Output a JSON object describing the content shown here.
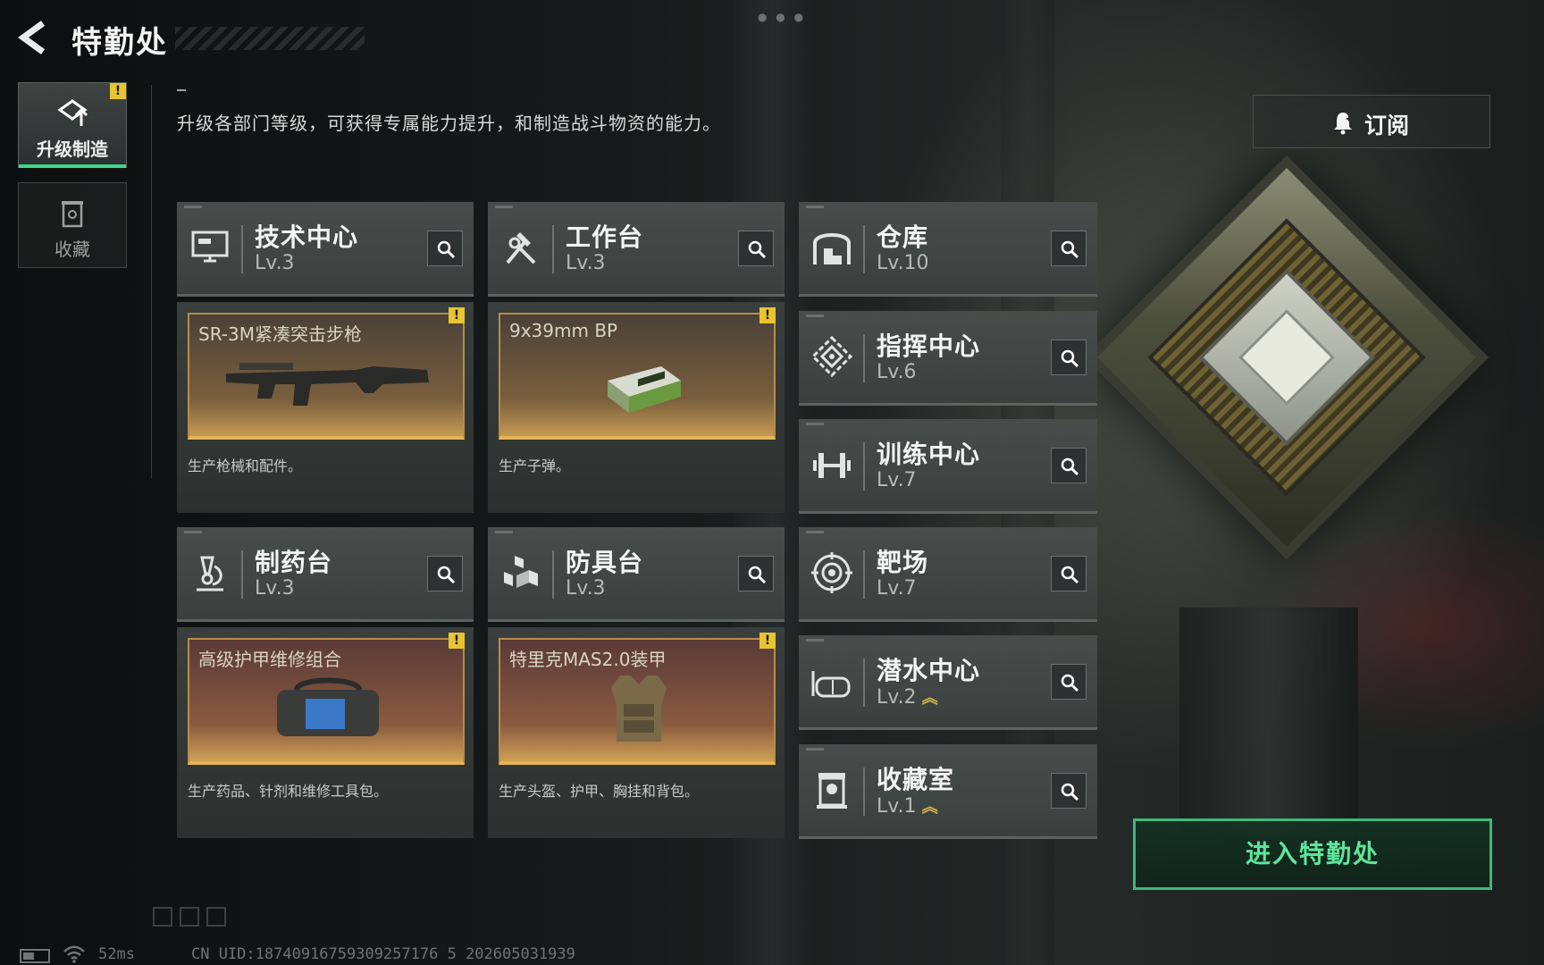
{
  "header": {
    "title": "特勤处"
  },
  "nav": {
    "tabs": [
      {
        "label": "升级制造",
        "icon": "upgrade-icon",
        "badge": "!"
      },
      {
        "label": "收藏",
        "icon": "collection-icon"
      }
    ]
  },
  "main": {
    "description": "升级各部门等级，可获得专属能力提升，和制造战斗物资的能力。",
    "subscribe_label": "订阅",
    "enter_label": "进入特勤处"
  },
  "facilities": [
    {
      "name": "技术中心",
      "level": "Lv.3",
      "icon": "computer-icon"
    },
    {
      "name": "工作台",
      "level": "Lv.3",
      "icon": "hammer-wrench-icon"
    },
    {
      "name": "仓库",
      "level": "Lv.10",
      "icon": "warehouse-icon"
    },
    {
      "name": "指挥中心",
      "level": "Lv.6",
      "icon": "command-icon"
    },
    {
      "name": "训练中心",
      "level": "Lv.7",
      "icon": "dumbbell-icon"
    },
    {
      "name": "制药台",
      "level": "Lv.3",
      "icon": "microscope-icon"
    },
    {
      "name": "防具台",
      "level": "Lv.3",
      "icon": "armor-blocks-icon"
    },
    {
      "name": "靶场",
      "level": "Lv.7",
      "icon": "target-icon"
    },
    {
      "name": "潜水中心",
      "level": "Lv.2",
      "icon": "diving-mask-icon",
      "upgradable": true
    },
    {
      "name": "收藏室",
      "level": "Lv.1",
      "icon": "trophy-case-icon",
      "upgradable": true
    }
  ],
  "productions": [
    {
      "item": "SR-3M紧凑突击步枪",
      "desc": "生产枪械和配件。",
      "badge": "!"
    },
    {
      "item": "9x39mm BP",
      "desc": "生产子弹。",
      "badge": "!"
    },
    {
      "item": "高级护甲维修组合",
      "desc": "生产药品、针剂和维修工具包。",
      "badge": "!"
    },
    {
      "item": "特里克MAS2.0装甲",
      "desc": "生产头盔、护甲、胸挂和背包。",
      "badge": "!"
    }
  ],
  "status": {
    "ping": "52ms",
    "uid": "CN UID:18740916759309257176 5 202605031939"
  },
  "colors": {
    "accent": "#3ed68a",
    "badge": "#e8c431",
    "frame": "#e5b455"
  }
}
